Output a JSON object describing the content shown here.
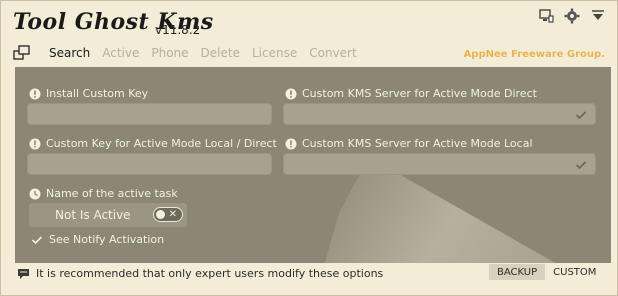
{
  "app": {
    "title": "Tool Ghost Kms",
    "version": "v11.8.2",
    "watermark": "AppNee Freeware Group."
  },
  "top_icons": [
    "monitor-icon",
    "gear-icon",
    "menu-icon"
  ],
  "nav": {
    "items": [
      {
        "label": "Search",
        "active": true
      },
      {
        "label": "Active",
        "active": false
      },
      {
        "label": "Phone",
        "active": false
      },
      {
        "label": "Delete",
        "active": false
      },
      {
        "label": "License",
        "active": false
      },
      {
        "label": "Convert",
        "active": false
      }
    ]
  },
  "form": {
    "install_key_label": "Install Custom Key",
    "install_key_value": "",
    "kms_direct_label": "Custom KMS Server for Active Mode Direct",
    "kms_direct_value": "",
    "key_local_label": "Custom Key for Active Mode Local / Direct",
    "key_local_value": "",
    "kms_local_label": "Custom KMS Server for Active Mode Local",
    "kms_local_value": "",
    "task_label": "Name of the active task",
    "task_status": "Not Is Active",
    "notify_label": "See Notify Activation"
  },
  "footer": {
    "note": "It is recommended that only expert users modify these options",
    "tabs": [
      {
        "label": "BACKUP",
        "active": false
      },
      {
        "label": "CUSTOM",
        "active": true
      }
    ]
  },
  "colors": {
    "background": "#f3ecd6",
    "panel": "#8b8676",
    "watermark": "#e8b24a"
  }
}
